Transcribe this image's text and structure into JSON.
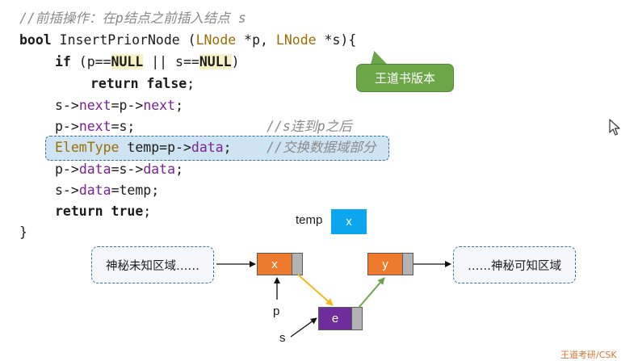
{
  "code": {
    "comment_header": "//前插操作：在p结点之前插入结点 s",
    "line1": {
      "kw": "bool",
      "sig_a": " InsertPriorNode (",
      "type1": "LNode",
      "sig_b": " *p, ",
      "type2": "LNode",
      "sig_c": " *s){"
    },
    "line2": {
      "kw": "if",
      "a": " (p==",
      "null1": "NULL",
      "b": " || s==",
      "null2": "NULL",
      "c": ")"
    },
    "line3": {
      "kw": "return",
      "sp": " ",
      "val": "false",
      "end": ";"
    },
    "line4": {
      "a": "s->",
      "f1": "next",
      "b": "=p->",
      "f2": "next",
      "c": ";"
    },
    "line5": {
      "a": "p->",
      "f1": "next",
      "b": "=s;",
      "comment": "//s连到p之后"
    },
    "line6": {
      "type": "ElemType",
      "a": " temp=p->",
      "f1": "data",
      "b": ";",
      "comment": "//交换数据域部分"
    },
    "line7": {
      "a": "p->",
      "f1": "data",
      "b": "=s->",
      "f2": "data",
      "c": ";"
    },
    "line8": {
      "a": "s->",
      "f1": "data",
      "b": "=temp;"
    },
    "line9": {
      "kw": "return",
      "sp": " ",
      "val": "true",
      "end": ";"
    },
    "line10": "}"
  },
  "badge": {
    "label": "王道书版本"
  },
  "diagram": {
    "temp_label": "temp",
    "temp_value": "x",
    "left_unknown": "神秘未知区域……",
    "right_unknown": "……神秘可知区域",
    "node_p_value": "x",
    "node_s_value": "e",
    "node_next_value": "y",
    "label_p": "p",
    "label_s": "s"
  },
  "colors": {
    "node_orange": "#ee7a2e",
    "node_purple": "#6f2c9c",
    "temp_blue": "#0ba6ee",
    "highlight": "#cfe4f3",
    "badge_green": "#6ca747",
    "arrow_yellow": "#f4b919",
    "arrow_green": "#6ca747"
  },
  "footer": {
    "watermark": "王道考研/CSK"
  }
}
